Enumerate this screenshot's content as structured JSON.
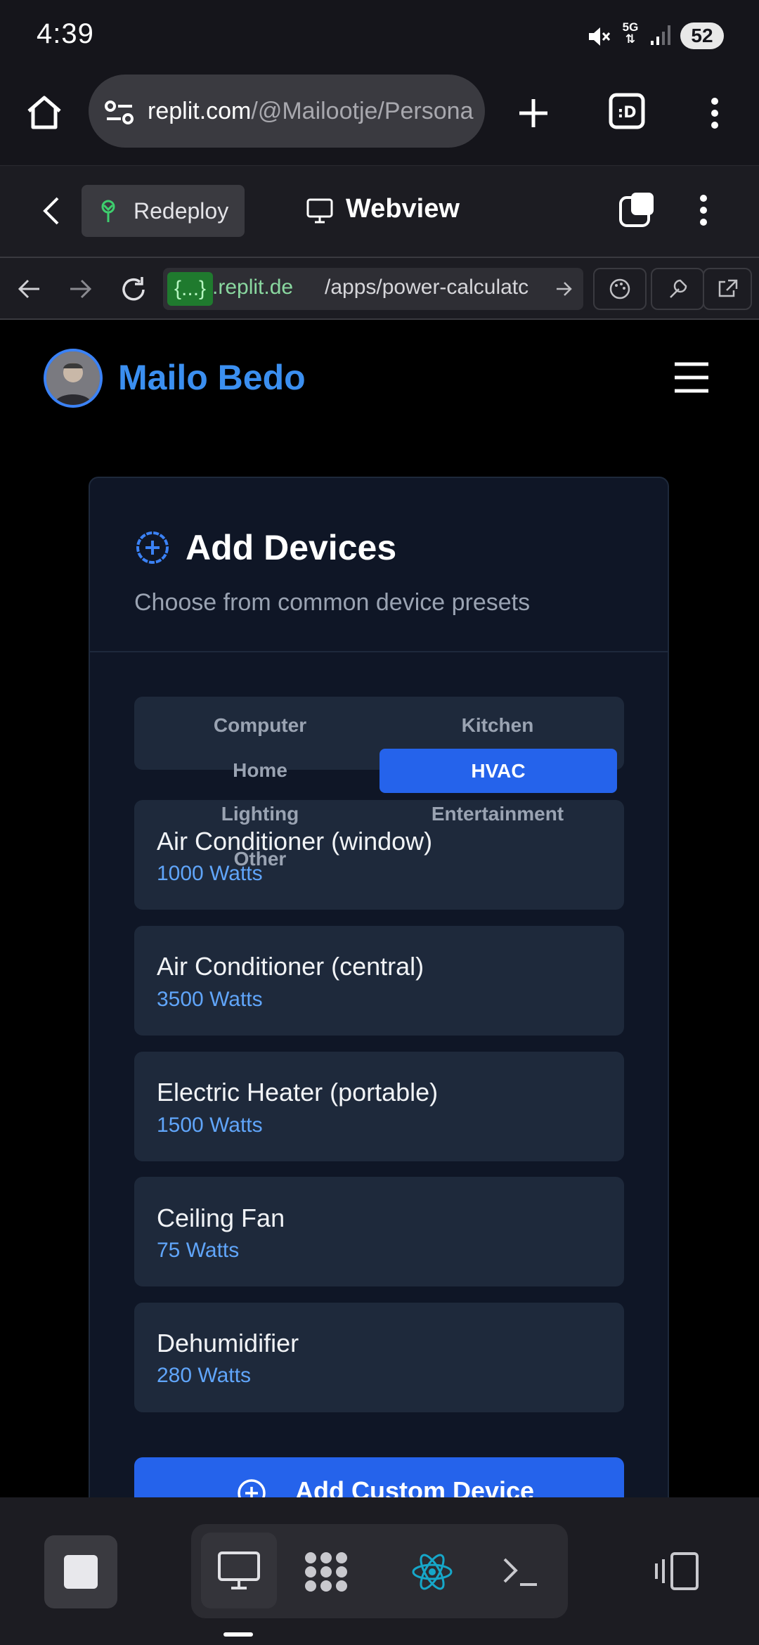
{
  "status_bar": {
    "time": "4:39",
    "network": "5G",
    "battery": "52"
  },
  "browser": {
    "url_host": "replit.com",
    "url_path": "/@Mailootje/Persona"
  },
  "replit_header": {
    "redeploy_label": "Redeploy",
    "webview_label": "Webview"
  },
  "devtools": {
    "url_chip": "{...}",
    "url_host": ".replit.de",
    "url_path": "/apps/power-calculatc"
  },
  "site": {
    "name": "Mailo Bedo"
  },
  "card": {
    "title": "Add Devices",
    "subtitle": "Choose from common device presets",
    "tabs": [
      "Computer",
      "Kitchen",
      "Home",
      "HVAC",
      "Lighting",
      "Entertainment",
      "Other"
    ],
    "active_tab": "HVAC",
    "devices": [
      {
        "name": "Air Conditioner (window)",
        "watts": "1000 Watts"
      },
      {
        "name": "Air Conditioner (central)",
        "watts": "3500 Watts"
      },
      {
        "name": "Electric Heater (portable)",
        "watts": "1500 Watts"
      },
      {
        "name": "Ceiling Fan",
        "watts": "75 Watts"
      },
      {
        "name": "Dehumidifier",
        "watts": "280 Watts"
      }
    ],
    "add_custom_label": "Add Custom Device"
  },
  "colors": {
    "accent": "#2563eb",
    "brand_name": "#3b8ff0",
    "watts_text": "#60a5fa",
    "card_bg": "#0f1626",
    "item_bg": "#1e293b"
  }
}
